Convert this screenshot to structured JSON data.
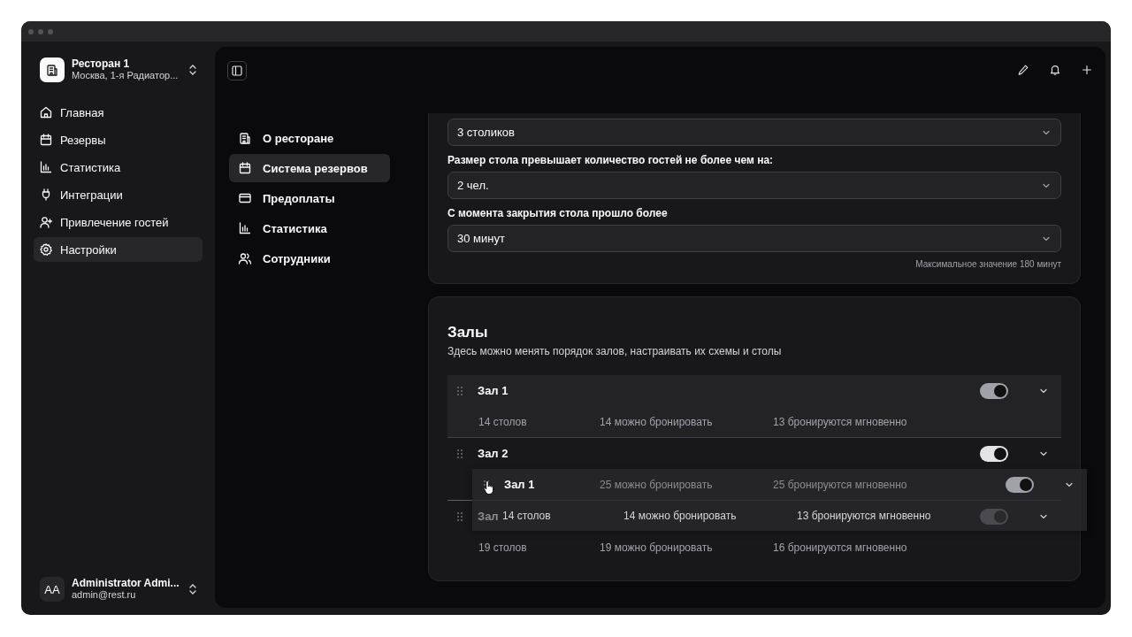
{
  "sidebar": {
    "restaurant": {
      "name": "Ресторан 1",
      "address": "Москва, 1-я Радиатор..."
    },
    "items": [
      {
        "label": "Главная",
        "selected": false
      },
      {
        "label": "Резервы",
        "selected": false
      },
      {
        "label": "Статистика",
        "selected": false
      },
      {
        "label": "Интеграции",
        "selected": false
      },
      {
        "label": "Привлечение гостей",
        "selected": false
      },
      {
        "label": "Настройки",
        "selected": true
      }
    ],
    "user": {
      "initials": "AA",
      "name": "Administrator Admi...",
      "email": "admin@rest.ru"
    }
  },
  "settings_nav": {
    "items": [
      {
        "label": "О ресторане",
        "selected": false
      },
      {
        "label": "Система резервов",
        "selected": true
      },
      {
        "label": "Предоплаты",
        "selected": false
      },
      {
        "label": "Статистика",
        "selected": false
      },
      {
        "label": "Сотрудники",
        "selected": false
      }
    ]
  },
  "fields": [
    {
      "value": "3 столиков"
    },
    {
      "label": "Размер стола превышает количество гостей не более чем на:",
      "value": "2 чел."
    },
    {
      "label": "С момента закрытия стола прошло более",
      "value": "30 минут",
      "hint": "Максимальное значение 180 минут"
    }
  ],
  "halls": {
    "title": "Залы",
    "subtitle": "Здесь можно менять порядок залов, настраивать их схемы и столы",
    "items": [
      {
        "name": "Зал 1",
        "on": true,
        "dragging": true,
        "drop_target": false,
        "stats": {
          "tables": "14 столов",
          "bookable": "14 можно бронировать",
          "instant": "13 бронируются мгновенно"
        }
      },
      {
        "name": "Зал 2",
        "on": true,
        "dragging": false,
        "drop_target": false,
        "stats": {
          "bookable": "25 можно бронировать",
          "instant": "25 бронируются мгновенно"
        }
      },
      {
        "name": "Зал",
        "on": true,
        "dragging": false,
        "drop_target": true,
        "stats": {
          "tables": "19 столов",
          "bookable": "19 можно бронировать",
          "instant": "16 бронируются мгновенно"
        }
      }
    ],
    "drag_preview": {
      "name": "Зал 1",
      "on": true,
      "stats": {
        "tables": "14 столов",
        "bookable": "14 можно бронировать",
        "instant": "13 бронируются мгновенно"
      }
    }
  }
}
